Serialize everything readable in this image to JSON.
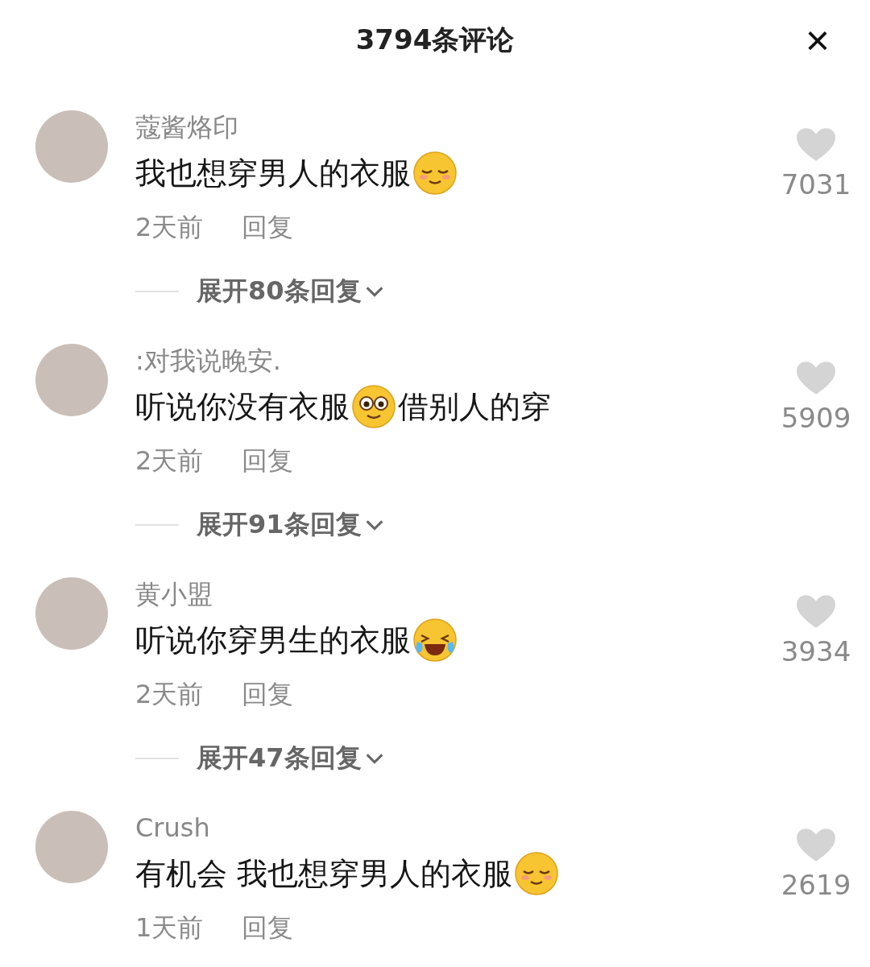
{
  "header": {
    "title": "3794条评论",
    "close": "×"
  },
  "comments": [
    {
      "user": "蔻酱烙印",
      "parts": [
        {
          "kind": "text",
          "text": "我也想穿男人的衣服"
        },
        {
          "kind": "shy"
        }
      ],
      "time": "2天前",
      "reply": "回复",
      "expand": "展开80条回复",
      "likes": "7031"
    },
    {
      "user": ":对我说晚安.",
      "parts": [
        {
          "kind": "text",
          "text": "听说你没有衣服"
        },
        {
          "kind": "stare"
        },
        {
          "kind": "text",
          "text": "借别人的穿"
        }
      ],
      "time": "2天前",
      "reply": "回复",
      "expand": "展开91条回复",
      "likes": "5909"
    },
    {
      "user": "黄小盟",
      "parts": [
        {
          "kind": "text",
          "text": "听说你穿男生的衣服"
        },
        {
          "kind": "laugh"
        }
      ],
      "time": "2天前",
      "reply": "回复",
      "expand": "展开47条回复",
      "likes": "3934"
    },
    {
      "user": "Crush",
      "parts": [
        {
          "kind": "text",
          "text": "有机会 我也想穿男人的衣服"
        },
        {
          "kind": "shy"
        }
      ],
      "time": "1天前",
      "reply": "回复",
      "likes": "2619"
    }
  ]
}
